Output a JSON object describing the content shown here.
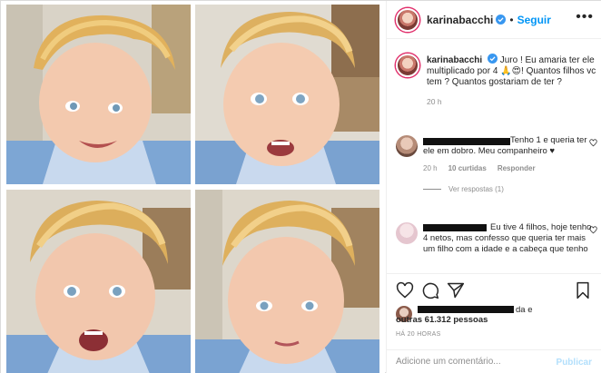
{
  "post": {
    "username": "karinabacchi",
    "follow_label": "Seguir",
    "more_label": "•••",
    "caption": {
      "username": "karinabacchi",
      "text": "Juro ! Eu amaria ter ele multiplicado por 4 🙏😍! Quantos filhos vc tem ? Quantos gostariam de ter ?",
      "time": "20 h"
    },
    "comments": [
      {
        "text": "Tenho 1 e queria ter ele em dobro. Meu companheiro ♥",
        "time": "20 h",
        "likes": "10 curtidas",
        "reply_label": "Responder",
        "view_replies": "Ver respostas (1)"
      },
      {
        "text": "Eu tive 4 filhos, hoje tenho 4 netos, mas confesso que queria ter mais um filho com a idade e a cabeça que tenho"
      }
    ],
    "likes": {
      "suffix_top": "da e",
      "count_text": "outras 61.312 pessoas"
    },
    "posted_time": "HÁ 20 HORAS",
    "add_comment": {
      "placeholder": "Adicione um comentário...",
      "publish_label": "Publicar"
    }
  },
  "colors": {
    "link_blue": "#0095f6",
    "publish_disabled": "#b2dffc",
    "muted": "#8e8e8e"
  },
  "icons": {
    "like": "heart-icon",
    "comment": "comment-icon",
    "share": "send-icon",
    "save": "bookmark-icon"
  }
}
